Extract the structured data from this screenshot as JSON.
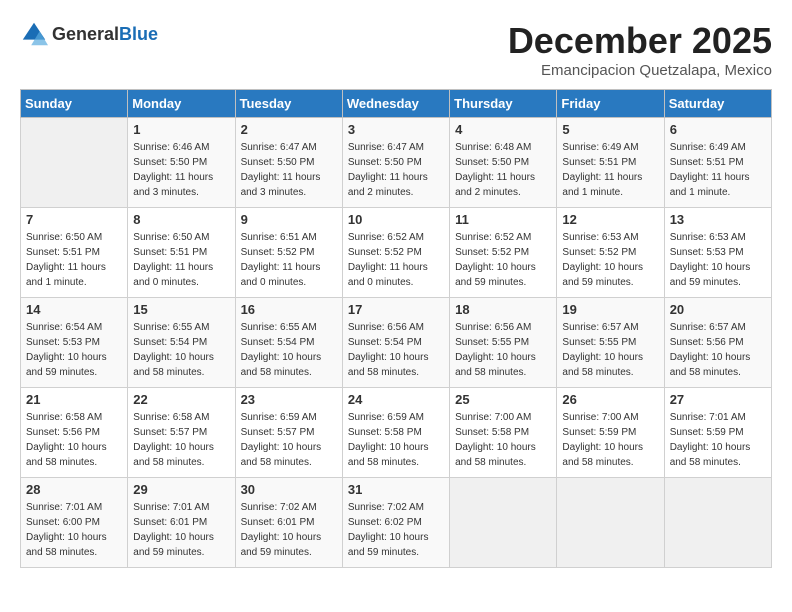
{
  "header": {
    "logo_general": "General",
    "logo_blue": "Blue",
    "month": "December 2025",
    "location": "Emancipacion Quetzalapa, Mexico"
  },
  "weekdays": [
    "Sunday",
    "Monday",
    "Tuesday",
    "Wednesday",
    "Thursday",
    "Friday",
    "Saturday"
  ],
  "weeks": [
    [
      {
        "day": "",
        "info": ""
      },
      {
        "day": "1",
        "info": "Sunrise: 6:46 AM\nSunset: 5:50 PM\nDaylight: 11 hours\nand 3 minutes."
      },
      {
        "day": "2",
        "info": "Sunrise: 6:47 AM\nSunset: 5:50 PM\nDaylight: 11 hours\nand 3 minutes."
      },
      {
        "day": "3",
        "info": "Sunrise: 6:47 AM\nSunset: 5:50 PM\nDaylight: 11 hours\nand 2 minutes."
      },
      {
        "day": "4",
        "info": "Sunrise: 6:48 AM\nSunset: 5:50 PM\nDaylight: 11 hours\nand 2 minutes."
      },
      {
        "day": "5",
        "info": "Sunrise: 6:49 AM\nSunset: 5:51 PM\nDaylight: 11 hours\nand 1 minute."
      },
      {
        "day": "6",
        "info": "Sunrise: 6:49 AM\nSunset: 5:51 PM\nDaylight: 11 hours\nand 1 minute."
      }
    ],
    [
      {
        "day": "7",
        "info": "Sunrise: 6:50 AM\nSunset: 5:51 PM\nDaylight: 11 hours\nand 1 minute."
      },
      {
        "day": "8",
        "info": "Sunrise: 6:50 AM\nSunset: 5:51 PM\nDaylight: 11 hours\nand 0 minutes."
      },
      {
        "day": "9",
        "info": "Sunrise: 6:51 AM\nSunset: 5:52 PM\nDaylight: 11 hours\nand 0 minutes."
      },
      {
        "day": "10",
        "info": "Sunrise: 6:52 AM\nSunset: 5:52 PM\nDaylight: 11 hours\nand 0 minutes."
      },
      {
        "day": "11",
        "info": "Sunrise: 6:52 AM\nSunset: 5:52 PM\nDaylight: 10 hours\nand 59 minutes."
      },
      {
        "day": "12",
        "info": "Sunrise: 6:53 AM\nSunset: 5:52 PM\nDaylight: 10 hours\nand 59 minutes."
      },
      {
        "day": "13",
        "info": "Sunrise: 6:53 AM\nSunset: 5:53 PM\nDaylight: 10 hours\nand 59 minutes."
      }
    ],
    [
      {
        "day": "14",
        "info": "Sunrise: 6:54 AM\nSunset: 5:53 PM\nDaylight: 10 hours\nand 59 minutes."
      },
      {
        "day": "15",
        "info": "Sunrise: 6:55 AM\nSunset: 5:54 PM\nDaylight: 10 hours\nand 58 minutes."
      },
      {
        "day": "16",
        "info": "Sunrise: 6:55 AM\nSunset: 5:54 PM\nDaylight: 10 hours\nand 58 minutes."
      },
      {
        "day": "17",
        "info": "Sunrise: 6:56 AM\nSunset: 5:54 PM\nDaylight: 10 hours\nand 58 minutes."
      },
      {
        "day": "18",
        "info": "Sunrise: 6:56 AM\nSunset: 5:55 PM\nDaylight: 10 hours\nand 58 minutes."
      },
      {
        "day": "19",
        "info": "Sunrise: 6:57 AM\nSunset: 5:55 PM\nDaylight: 10 hours\nand 58 minutes."
      },
      {
        "day": "20",
        "info": "Sunrise: 6:57 AM\nSunset: 5:56 PM\nDaylight: 10 hours\nand 58 minutes."
      }
    ],
    [
      {
        "day": "21",
        "info": "Sunrise: 6:58 AM\nSunset: 5:56 PM\nDaylight: 10 hours\nand 58 minutes."
      },
      {
        "day": "22",
        "info": "Sunrise: 6:58 AM\nSunset: 5:57 PM\nDaylight: 10 hours\nand 58 minutes."
      },
      {
        "day": "23",
        "info": "Sunrise: 6:59 AM\nSunset: 5:57 PM\nDaylight: 10 hours\nand 58 minutes."
      },
      {
        "day": "24",
        "info": "Sunrise: 6:59 AM\nSunset: 5:58 PM\nDaylight: 10 hours\nand 58 minutes."
      },
      {
        "day": "25",
        "info": "Sunrise: 7:00 AM\nSunset: 5:58 PM\nDaylight: 10 hours\nand 58 minutes."
      },
      {
        "day": "26",
        "info": "Sunrise: 7:00 AM\nSunset: 5:59 PM\nDaylight: 10 hours\nand 58 minutes."
      },
      {
        "day": "27",
        "info": "Sunrise: 7:01 AM\nSunset: 5:59 PM\nDaylight: 10 hours\nand 58 minutes."
      }
    ],
    [
      {
        "day": "28",
        "info": "Sunrise: 7:01 AM\nSunset: 6:00 PM\nDaylight: 10 hours\nand 58 minutes."
      },
      {
        "day": "29",
        "info": "Sunrise: 7:01 AM\nSunset: 6:01 PM\nDaylight: 10 hours\nand 59 minutes."
      },
      {
        "day": "30",
        "info": "Sunrise: 7:02 AM\nSunset: 6:01 PM\nDaylight: 10 hours\nand 59 minutes."
      },
      {
        "day": "31",
        "info": "Sunrise: 7:02 AM\nSunset: 6:02 PM\nDaylight: 10 hours\nand 59 minutes."
      },
      {
        "day": "",
        "info": ""
      },
      {
        "day": "",
        "info": ""
      },
      {
        "day": "",
        "info": ""
      }
    ]
  ]
}
